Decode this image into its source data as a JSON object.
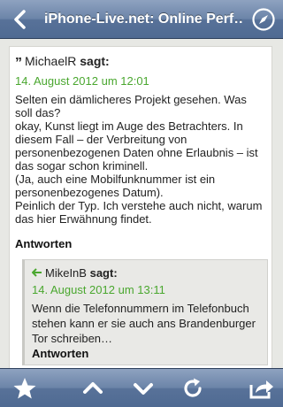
{
  "navbar": {
    "title": "iPhone-Live.net: Online Perf…"
  },
  "comment": {
    "author": "MichaelR",
    "says": "sagt:",
    "date": "14. August 2012 um 12:01",
    "paragraphs": [
      "Selten ein dämlicheres Projekt gesehen. Was soll das?",
      "okay, Kunst liegt im Auge des Betrachters. In diesem Fall – der Verbreitung von personenbezogenen Daten ohne Erlaubnis – ist das sogar schon kriminell.",
      "(Ja, auch eine Mobilfunknummer ist ein personenbezogenes Datum).",
      "Peinlich der Typ. Ich verstehe auch nicht, warum das hier Erwähnung findet."
    ],
    "reply_label": "Antworten"
  },
  "reply": {
    "author": "MikeInB",
    "says": "sagt:",
    "date": "14. August 2012 um 13:11",
    "body": "Wenn die Telefonnummern im Telefonbuch stehen kann er sie auch ans Brandenburger Tor schreiben…",
    "reply_label": "Antworten"
  },
  "toolbar": {
    "items": [
      "star-icon",
      "chevron-up-icon",
      "chevron-down-icon",
      "refresh-icon",
      "share-icon"
    ]
  },
  "colors": {
    "accent_green": "#4aa72f",
    "bar_blue": "#587299"
  }
}
